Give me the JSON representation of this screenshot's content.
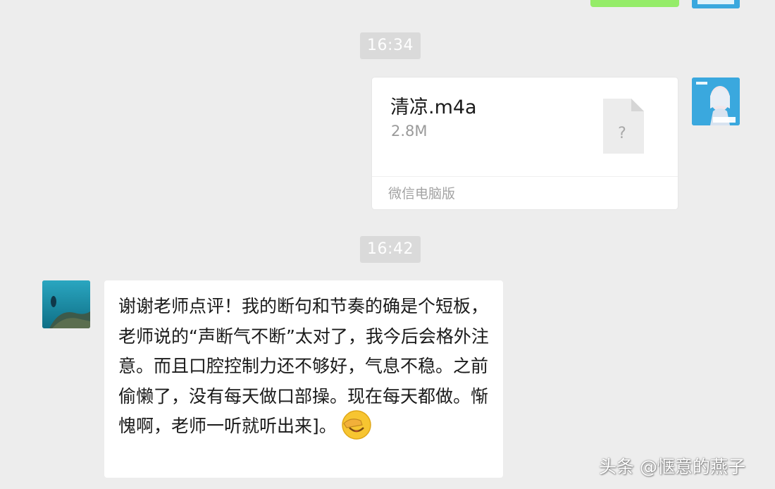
{
  "chat": {
    "time_1": "16:34",
    "time_2": "16:42",
    "file_message": {
      "file_name": "清凉.m4a",
      "file_size": "2.8M",
      "source": "微信电脑版",
      "file_type_icon": "unknown-file-icon"
    },
    "incoming_message": {
      "text": "谢谢老师点评！我的断句和节奏的确是个短板，老师说的“声断气不断”太对了，我今后会格外注意。而且口腔控制力还不够好，气息不稳。之前偷懒了，没有每天做口部操。现在每天都做。惭愧啊，老师一听就听出来]。",
      "emoji": "facepalm-emoji"
    }
  },
  "watermark": "头条 @惬意的燕子",
  "colors": {
    "background": "#ededed",
    "self_bubble": "#95ec69",
    "bubble": "#ffffff",
    "time_pill": "#dadada"
  }
}
